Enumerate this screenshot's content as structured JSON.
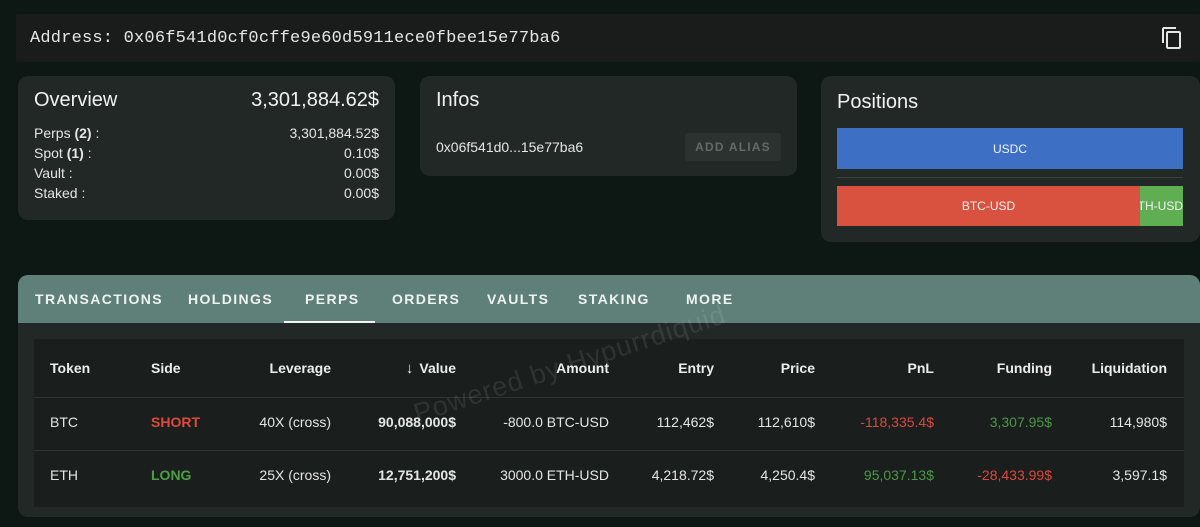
{
  "address_bar": {
    "label": "Address: 0x06f541d0cf0cffe9e60d5911ece0fbee15e77ba6",
    "copy_icon": "copy-icon"
  },
  "overview": {
    "title": "Overview",
    "total": "3,301,884.62$",
    "rows": [
      {
        "label": "Perps",
        "count": "(2)",
        "suffix": " :",
        "value": "3,301,884.52$"
      },
      {
        "label": "Spot",
        "count": "(1)",
        "suffix": " :",
        "value": "0.10$"
      },
      {
        "label": "Vault :",
        "count": "",
        "suffix": "",
        "value": "0.00$"
      },
      {
        "label": "Staked :",
        "count": "",
        "suffix": "",
        "value": "0.00$"
      }
    ]
  },
  "infos": {
    "title": "Infos",
    "address_short": "0x06f541d0...15e77ba6",
    "alias_button": "ADD ALIAS"
  },
  "positions": {
    "title": "Positions",
    "bars": [
      {
        "label": "USDC",
        "color": "#3d6fc4",
        "share": 1.0
      },
      {
        "label": "BTC-USD",
        "color": "#d9513f",
        "share": 0.876
      },
      {
        "label": "ETH-USD",
        "color": "#5fae52",
        "share": 0.124
      }
    ]
  },
  "tabs": {
    "items": [
      "TRANSACTIONS",
      "HOLDINGS",
      "PERPS",
      "ORDERS",
      "VAULTS",
      "STAKING",
      "MORE"
    ],
    "active": "PERPS"
  },
  "table": {
    "headers": {
      "token": "Token",
      "side": "Side",
      "leverage": "Leverage",
      "sort_arrow": "↓",
      "value": "Value",
      "amount": "Amount",
      "entry": "Entry",
      "price": "Price",
      "pnl": "PnL",
      "funding": "Funding",
      "liquidation": "Liquidation"
    },
    "rows": [
      {
        "token": "BTC",
        "side": "SHORT",
        "leverage": "40X (cross)",
        "value": "90,088,000$",
        "amount": "-800.0 BTC-USD",
        "entry": "112,462$",
        "price": "112,610$",
        "pnl": "-118,335.4$",
        "funding": "3,307.95$",
        "liquidation": "114,980$"
      },
      {
        "token": "ETH",
        "side": "LONG",
        "leverage": "25X (cross)",
        "value": "12,751,200$",
        "amount": "3000.0 ETH-USD",
        "entry": "4,218.72$",
        "price": "4,250.4$",
        "pnl": "95,037.13$",
        "funding": "-28,433.99$",
        "liquidation": "3,597.1$"
      }
    ]
  },
  "watermark": "Powered by Hypurrdiquid",
  "colors": {
    "background": "#0d1815",
    "card": "#222826",
    "tabbar": "#5f7f79",
    "short": "#e04a3a",
    "long": "#4e9e45"
  }
}
